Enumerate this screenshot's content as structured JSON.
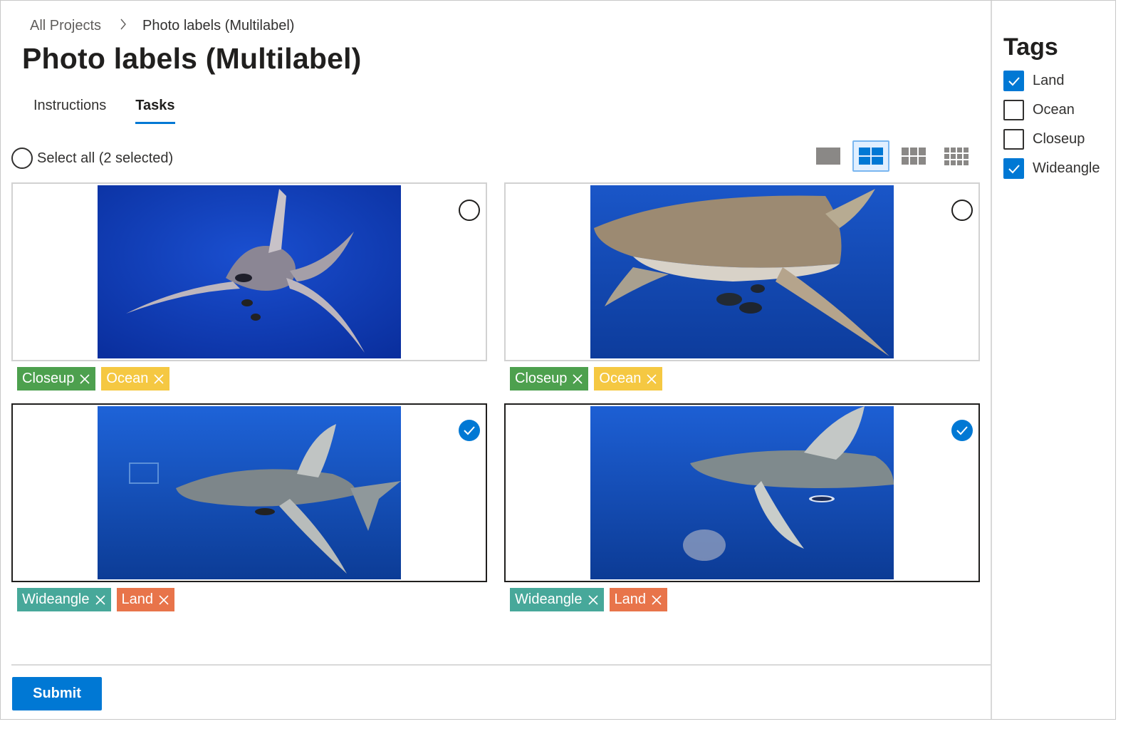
{
  "breadcrumb": {
    "root": "All Projects",
    "current": "Photo labels (Multilabel)"
  },
  "page_title": "Photo labels (Multilabel)",
  "tabs": [
    {
      "label": "Instructions",
      "active": false
    },
    {
      "label": "Tasks",
      "active": true
    }
  ],
  "select_all": {
    "label": "Select all (2 selected)"
  },
  "view_modes": [
    "single",
    "two-by-two",
    "three-column",
    "four-column"
  ],
  "active_view_mode": "two-by-two",
  "cards": [
    {
      "selected": false,
      "tags": [
        {
          "label": "Closeup",
          "color": "#4da04e"
        },
        {
          "label": "Ocean",
          "color": "#f5c842"
        }
      ]
    },
    {
      "selected": false,
      "tags": [
        {
          "label": "Closeup",
          "color": "#4da04e"
        },
        {
          "label": "Ocean",
          "color": "#f5c842"
        }
      ]
    },
    {
      "selected": true,
      "tags": [
        {
          "label": "Wideangle",
          "color": "#47a89a"
        },
        {
          "label": "Land",
          "color": "#e8744a"
        }
      ]
    },
    {
      "selected": true,
      "tags": [
        {
          "label": "Wideangle",
          "color": "#47a89a"
        },
        {
          "label": "Land",
          "color": "#e8744a"
        }
      ]
    }
  ],
  "submit": {
    "label": "Submit"
  },
  "tags_panel": {
    "title": "Tags",
    "options": [
      {
        "label": "Land",
        "checked": true
      },
      {
        "label": "Ocean",
        "checked": false
      },
      {
        "label": "Closeup",
        "checked": false
      },
      {
        "label": "Wideangle",
        "checked": true
      }
    ]
  },
  "colors": {
    "accent": "#0078d4",
    "ocean_blue": "#0c3fb8"
  }
}
